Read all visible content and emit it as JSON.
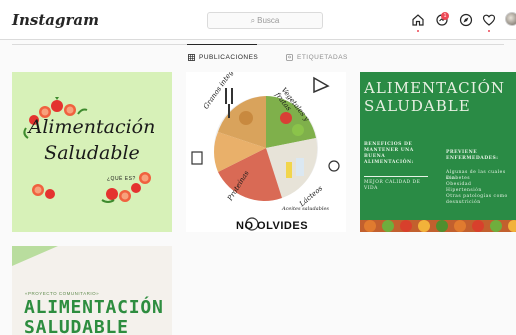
{
  "app": {
    "logo": "Instagram"
  },
  "search": {
    "placeholder": "Busca",
    "icon": "search-icon"
  },
  "nav": {
    "icons": [
      "home-icon",
      "messages-icon",
      "explore-icon",
      "heart-icon",
      "avatar"
    ],
    "messages_badge": "1"
  },
  "tabs": [
    {
      "label": "PUBLICACIONES",
      "icon": "grid-icon",
      "active": true
    },
    {
      "label": "ETIQUETADAS",
      "icon": "tag-icon",
      "active": false
    }
  ],
  "posts": {
    "p1": {
      "line1": "Alimentación",
      "line2": "Saludable",
      "sub": "¿QUÉ ES?",
      "bg": "#d7f1b8"
    },
    "p2": {
      "labels": [
        "Granos integrales",
        "Vegetales y frutas",
        "Proteínas",
        "Lácteos",
        "Aceites saludables"
      ],
      "bottom": "NO OLVIDES"
    },
    "p3": {
      "title1": "ALIMENTACIÓN",
      "title2": "SALUDABLE",
      "left_heading": "BENEFICIOS DE MANTENER UNA BUENA ALIMENTACIÓN:",
      "left_sub": "MEJOR CALIDAD DE VIDA",
      "right_heading": "PREVIENE ENFERMEDADES:",
      "right_lines": [
        "Algunas de las cuales son:",
        "Diabetes",
        "Obesidad",
        "Hipertensión",
        "Otras patologías como",
        "desnutrición"
      ],
      "bg": "#2a8b45"
    },
    "p4": {
      "small": "«PROYECTO COMUNITARIO»",
      "line1": "ALIMENTACIÓN",
      "line2": "SALUDABLE"
    }
  }
}
